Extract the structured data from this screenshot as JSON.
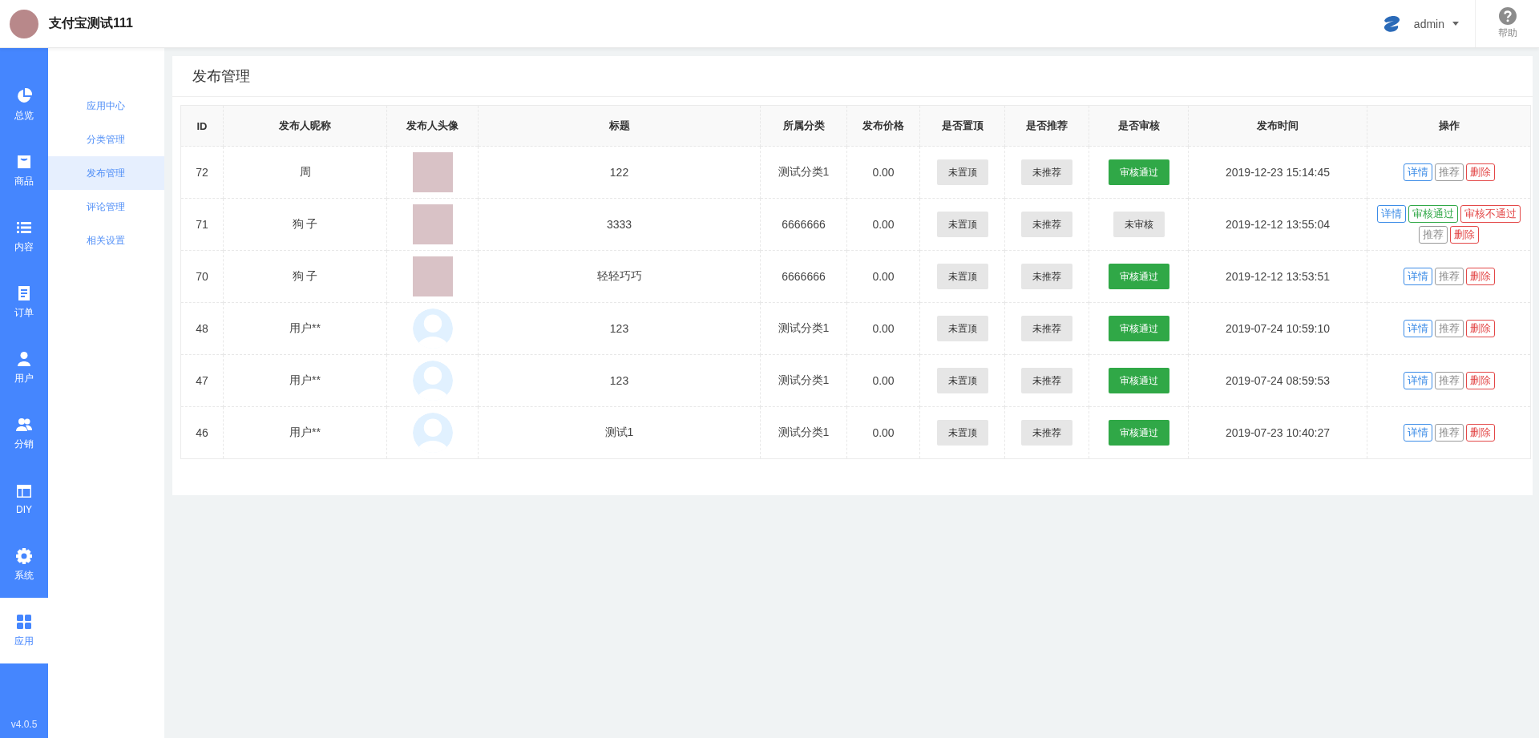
{
  "header": {
    "site_name": "支付宝测试111",
    "user": "admin",
    "help": "帮助"
  },
  "rail": [
    {
      "kind": "pie",
      "label": "总览",
      "selected": false
    },
    {
      "kind": "bag",
      "label": "商品",
      "selected": false
    },
    {
      "kind": "list",
      "label": "内容",
      "selected": false
    },
    {
      "kind": "doc",
      "label": "订单",
      "selected": false
    },
    {
      "kind": "user",
      "label": "用户",
      "selected": false
    },
    {
      "kind": "users",
      "label": "分销",
      "selected": false
    },
    {
      "kind": "layout",
      "label": "DIY",
      "selected": false
    },
    {
      "kind": "gear",
      "label": "系统",
      "selected": false
    },
    {
      "kind": "grid",
      "label": "应用",
      "selected": true
    }
  ],
  "version": "v4.0.5",
  "subnav": [
    {
      "label": "应用中心",
      "selected": false
    },
    {
      "label": "分类管理",
      "selected": false
    },
    {
      "label": "发布管理",
      "selected": true
    },
    {
      "label": "评论管理",
      "selected": false
    },
    {
      "label": "相关设置",
      "selected": false
    }
  ],
  "page_title": "发布管理",
  "table": {
    "columns": [
      "ID",
      "发布人昵称",
      "发布人头像",
      "标题",
      "所属分类",
      "发布价格",
      "是否置顶",
      "是否推荐",
      "是否审核",
      "发布时间",
      "操作"
    ],
    "rows": [
      {
        "kind": "photo",
        "id": "72",
        "nickname": "周",
        "title": "122",
        "category": "测试分类1",
        "price": "0.00",
        "pinned": {
          "label": "未置顶",
          "on": false
        },
        "recommended": {
          "label": "未推荐",
          "on": false
        },
        "review": {
          "label": "审核通过",
          "approved": true
        },
        "time": "2019-12-23 15:14:45",
        "actions": [
          {
            "kind": "detail",
            "label": "详情"
          },
          {
            "kind": "recommend",
            "label": "推荐"
          },
          {
            "kind": "delete",
            "label": "删除"
          }
        ]
      },
      {
        "kind": "photo",
        "id": "71",
        "nickname": "狗 子",
        "title": "3333",
        "category": "6666666",
        "price": "0.00",
        "pinned": {
          "label": "未置顶",
          "on": false
        },
        "recommended": {
          "label": "未推荐",
          "on": false
        },
        "review": {
          "label": "未审核",
          "approved": false
        },
        "time": "2019-12-12 13:55:04",
        "actions": [
          {
            "kind": "detail",
            "label": "详情"
          },
          {
            "kind": "approve",
            "label": "审核通过"
          },
          {
            "kind": "reject",
            "label": "审核不通过"
          },
          {
            "kind": "recommend",
            "label": "推荐"
          },
          {
            "kind": "delete",
            "label": "删除"
          }
        ]
      },
      {
        "kind": "photo",
        "id": "70",
        "nickname": "狗 子",
        "title": "轻轻巧巧",
        "category": "6666666",
        "price": "0.00",
        "pinned": {
          "label": "未置顶",
          "on": false
        },
        "recommended": {
          "label": "未推荐",
          "on": false
        },
        "review": {
          "label": "审核通过",
          "approved": true
        },
        "time": "2019-12-12 13:53:51",
        "actions": [
          {
            "kind": "detail",
            "label": "详情"
          },
          {
            "kind": "recommend",
            "label": "推荐"
          },
          {
            "kind": "delete",
            "label": "删除"
          }
        ]
      },
      {
        "kind": "default",
        "id": "48",
        "nickname": "用户**",
        "title": "123",
        "category": "测试分类1",
        "price": "0.00",
        "pinned": {
          "label": "未置顶",
          "on": false
        },
        "recommended": {
          "label": "未推荐",
          "on": false
        },
        "review": {
          "label": "审核通过",
          "approved": true
        },
        "time": "2019-07-24 10:59:10",
        "actions": [
          {
            "kind": "detail",
            "label": "详情"
          },
          {
            "kind": "recommend",
            "label": "推荐"
          },
          {
            "kind": "delete",
            "label": "删除"
          }
        ]
      },
      {
        "kind": "default",
        "id": "47",
        "nickname": "用户**",
        "title": "123",
        "category": "测试分类1",
        "price": "0.00",
        "pinned": {
          "label": "未置顶",
          "on": false
        },
        "recommended": {
          "label": "未推荐",
          "on": false
        },
        "review": {
          "label": "审核通过",
          "approved": true
        },
        "time": "2019-07-24 08:59:53",
        "actions": [
          {
            "kind": "detail",
            "label": "详情"
          },
          {
            "kind": "recommend",
            "label": "推荐"
          },
          {
            "kind": "delete",
            "label": "删除"
          }
        ]
      },
      {
        "kind": "default",
        "id": "46",
        "nickname": "用户**",
        "title": "测试1",
        "category": "测试分类1",
        "price": "0.00",
        "pinned": {
          "label": "未置顶",
          "on": false
        },
        "recommended": {
          "label": "未推荐",
          "on": false
        },
        "review": {
          "label": "审核通过",
          "approved": true
        },
        "time": "2019-07-23 10:40:27",
        "actions": [
          {
            "kind": "detail",
            "label": "详情"
          },
          {
            "kind": "recommend",
            "label": "推荐"
          },
          {
            "kind": "delete",
            "label": "删除"
          }
        ]
      }
    ]
  }
}
